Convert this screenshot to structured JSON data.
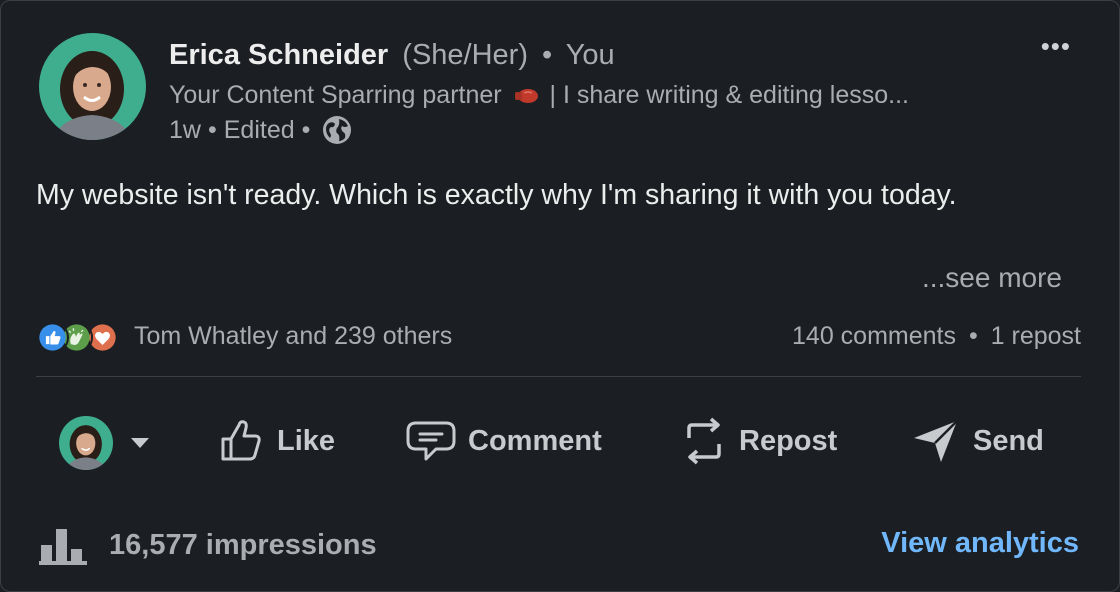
{
  "post": {
    "author": {
      "name": "Erica Schneider",
      "pronouns": "(She/Her)",
      "relation": "You",
      "headline_before": "Your Content Sparring partner",
      "headline_after": "| I share writing & editing lesso...",
      "time": "1w",
      "edited": "Edited",
      "visibility_icon": "globe-icon"
    },
    "more_icon": "•••",
    "body": "My website isn't ready. Which is exactly why I'm sharing it with you today.",
    "see_more": "...see more",
    "reactions": {
      "icons": [
        "like-reaction-icon",
        "celebrate-reaction-icon",
        "love-reaction-icon"
      ],
      "summary": "Tom Whatley and 239 others"
    },
    "comments_count": "140 comments",
    "reposts_count": "1 repost"
  },
  "actions": {
    "like": "Like",
    "comment": "Comment",
    "repost": "Repost",
    "send": "Send"
  },
  "footer": {
    "impressions": "16,577 impressions",
    "analytics_link": "View analytics"
  },
  "colors": {
    "background": "#1b1f23",
    "text_primary": "#eceded",
    "text_secondary": "#a9adb1",
    "link": "#71b7fb",
    "divider": "#3c4045"
  }
}
